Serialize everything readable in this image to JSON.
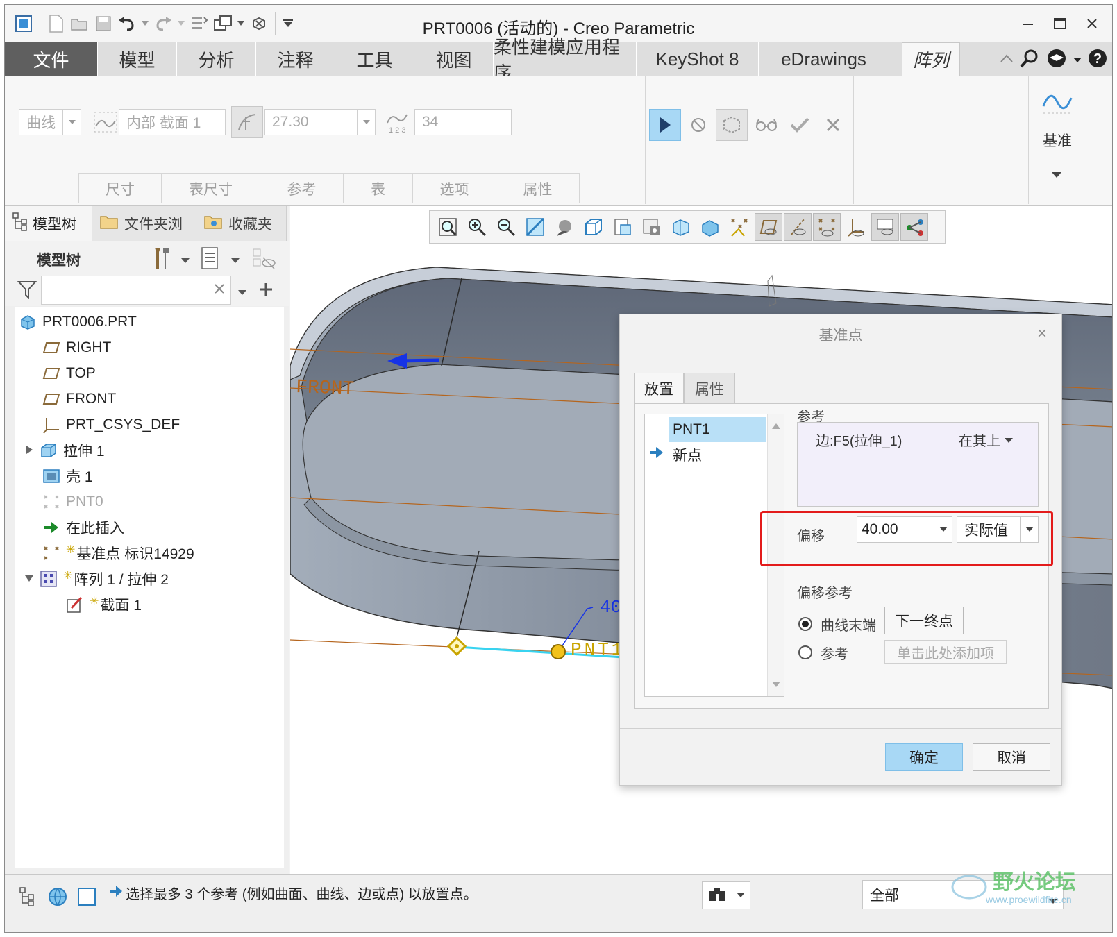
{
  "window": {
    "title": "PRT0006 (活动的) - Creo Parametric"
  },
  "ribbon_tabs": [
    "文件",
    "模型",
    "分析",
    "注释",
    "工具",
    "视图",
    "柔性建模应用程序",
    "KeyShot 8",
    "eDrawings",
    "阵列"
  ],
  "pattern_ribbon": {
    "type_select": "曲线",
    "sketch_field": "内部 截面 1",
    "spacing_value": "27.30",
    "count_value": "34",
    "groups": [
      "尺寸",
      "表尺寸",
      "参考",
      "表",
      "选项",
      "属性"
    ],
    "datum_label": "基准"
  },
  "left_panel": {
    "tabs": [
      "模型树",
      "文件夹浏",
      "收藏夹"
    ],
    "tree_title": "模型树",
    "filter_placeholder": "",
    "tree_items": [
      {
        "label": "PRT0006.PRT",
        "icon": "part-icon"
      },
      {
        "label": "RIGHT",
        "icon": "datum-plane-icon"
      },
      {
        "label": "TOP",
        "icon": "datum-plane-icon"
      },
      {
        "label": "FRONT",
        "icon": "datum-plane-icon"
      },
      {
        "label": "PRT_CSYS_DEF",
        "icon": "csys-icon"
      },
      {
        "label": "拉伸 1",
        "icon": "extrude-icon"
      },
      {
        "label": "壳 1",
        "icon": "shell-icon"
      },
      {
        "label": "PNT0",
        "icon": "datum-point-icon"
      },
      {
        "label": "在此插入",
        "icon": "insert-arrow-icon"
      },
      {
        "label": "基准点 标识14929",
        "icon": "datum-point-icon"
      },
      {
        "label": "阵列 1 / 拉伸 2",
        "icon": "pattern-icon"
      },
      {
        "label": "截面 1",
        "icon": "sketch-icon"
      }
    ]
  },
  "graphics": {
    "labels": {
      "front_plane": "FRONT",
      "dimension": "40",
      "point_label": "PNT1"
    }
  },
  "dialog": {
    "title": "基准点",
    "tabs": [
      "放置",
      "属性"
    ],
    "points": [
      "PNT1",
      "新点"
    ],
    "reference_label": "参考",
    "reference_item": "边:F5(拉伸_1)",
    "reference_constraint": "在其上",
    "offset_label": "偏移",
    "offset_value": "40.00",
    "offset_type": "实际值",
    "offset_ref_label": "偏移参考",
    "radio_curve_end": "曲线末端",
    "next_end_button": "下一终点",
    "radio_reference": "参考",
    "add_item_placeholder": "单击此处添加项",
    "ok_button": "确定",
    "cancel_button": "取消"
  },
  "status_bar": {
    "message": "选择最多 3 个参考 (例如曲面、曲线、边或点) 以放置点。",
    "filter_value": "全部"
  },
  "watermark": {
    "text": "野火论坛",
    "url": "www.proewildfire.cn"
  },
  "colors": {
    "file_tab": "#5f5f5f",
    "accent_selected": "#b9e0f7",
    "highlight_box": "#e31b1b",
    "model_body": "#8d99a8"
  }
}
